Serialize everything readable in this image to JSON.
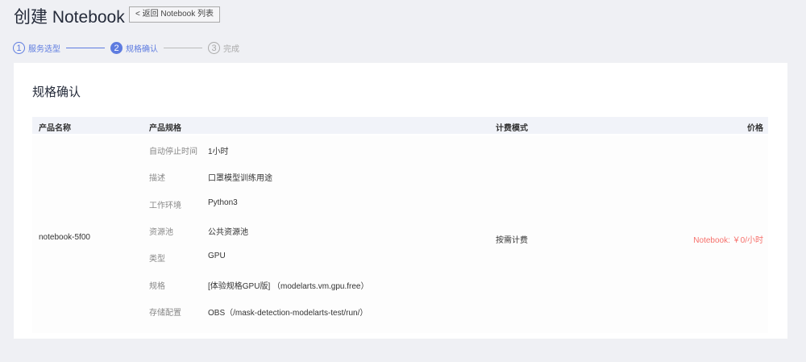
{
  "header": {
    "title": "创建 Notebook",
    "back_label": "< 返回 Notebook 列表"
  },
  "steps": [
    {
      "num": "1",
      "label": "服务选型"
    },
    {
      "num": "2",
      "label": "规格确认"
    },
    {
      "num": "3",
      "label": "完成"
    }
  ],
  "section_title": "规格确认",
  "table": {
    "headers": [
      "产品名称",
      "产品规格",
      "计费模式",
      "价格"
    ],
    "row": {
      "name": "notebook-5f00",
      "specs": [
        {
          "label": "自动停止时间",
          "value": "1小时"
        },
        {
          "label": "描述",
          "value": "口罩模型训练用途"
        },
        {
          "label": "工作环境",
          "value": "Python3"
        },
        {
          "label": "资源池",
          "value": "公共资源池"
        },
        {
          "label": "类型",
          "value": "GPU"
        },
        {
          "label": "规格",
          "value": "[体验规格GPU版] （modelarts.vm.gpu.free）"
        },
        {
          "label": "存储配置",
          "value": "OBS（/mask-detection-modelarts-test/run/）"
        }
      ],
      "billing": "按需计费",
      "price": "Notebook: ￥0/小时"
    }
  },
  "colors": {
    "accent": "#5e7ce0",
    "price": "#f66f6a"
  }
}
